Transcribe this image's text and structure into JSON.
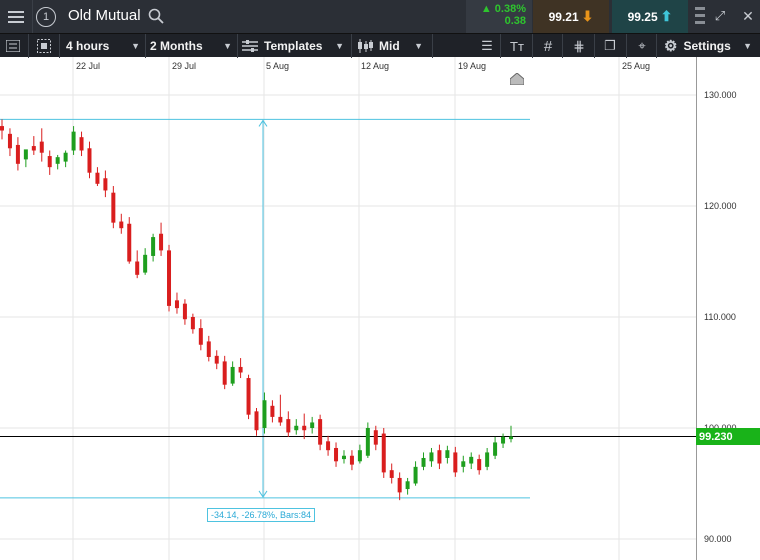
{
  "header": {
    "title": "Old Mutual",
    "change_pct": "0.38%",
    "change_abs": "0.38",
    "sell_price": "99.21",
    "buy_price": "99.25",
    "badge": "1"
  },
  "toolbar": {
    "interval": "4 hours",
    "range": "2 Months",
    "templates": "Templates",
    "price_type": "Mid",
    "settings": "Settings"
  },
  "x_axis": {
    "labels": [
      "22 Jul",
      "29 Jul",
      "5 Aug",
      "12 Aug",
      "19 Aug",
      "25 Aug"
    ]
  },
  "y_axis": {
    "labels": [
      "130.000",
      "120.000",
      "110.000",
      "100.000",
      "90.000"
    ]
  },
  "current_price": "99.230",
  "measure_label": "-34.14, -26.78%, Bars:84",
  "colors": {
    "up": "#1e9e1e",
    "down": "#d91e1e",
    "measure": "#4ec3e0",
    "price_tag": "#19b319"
  },
  "chart_data": {
    "type": "candlestick",
    "ylim": [
      89,
      132
    ],
    "candles": [
      {
        "o": 127.2,
        "h": 127.8,
        "c": 126.8,
        "l": 126.0
      },
      {
        "o": 126.5,
        "h": 127.0,
        "c": 125.2,
        "l": 124.5
      },
      {
        "o": 125.5,
        "h": 126.2,
        "c": 123.8,
        "l": 123.2
      },
      {
        "o": 124.2,
        "h": 125.0,
        "c": 125.1,
        "l": 123.5
      },
      {
        "o": 125.4,
        "h": 126.3,
        "c": 125.0,
        "l": 124.6
      },
      {
        "o": 125.8,
        "h": 127.0,
        "c": 124.8,
        "l": 124.0
      },
      {
        "o": 124.5,
        "h": 125.0,
        "c": 123.5,
        "l": 122.8
      },
      {
        "o": 123.8,
        "h": 124.6,
        "c": 124.4,
        "l": 123.3
      },
      {
        "o": 124.0,
        "h": 125.0,
        "c": 124.8,
        "l": 123.5
      },
      {
        "o": 125.0,
        "h": 127.2,
        "c": 126.7,
        "l": 124.6
      },
      {
        "o": 126.2,
        "h": 126.7,
        "c": 125.0,
        "l": 124.5
      },
      {
        "o": 125.2,
        "h": 125.8,
        "c": 123.0,
        "l": 122.5
      },
      {
        "o": 123.0,
        "h": 123.5,
        "c": 122.0,
        "l": 121.8
      },
      {
        "o": 122.5,
        "h": 123.2,
        "c": 121.4,
        "l": 120.8
      },
      {
        "o": 121.2,
        "h": 121.8,
        "c": 118.5,
        "l": 118.0
      },
      {
        "o": 118.6,
        "h": 119.3,
        "c": 118.0,
        "l": 117.5
      },
      {
        "o": 118.4,
        "h": 119.0,
        "c": 115.0,
        "l": 114.8
      },
      {
        "o": 115.0,
        "h": 116.0,
        "c": 113.8,
        "l": 113.5
      },
      {
        "o": 114.0,
        "h": 116.2,
        "c": 115.6,
        "l": 113.8
      },
      {
        "o": 115.5,
        "h": 117.5,
        "c": 117.2,
        "l": 115.0
      },
      {
        "o": 117.5,
        "h": 118.5,
        "c": 116.0,
        "l": 115.5
      },
      {
        "o": 116.0,
        "h": 116.5,
        "c": 111.0,
        "l": 110.5
      },
      {
        "o": 111.5,
        "h": 112.2,
        "c": 110.8,
        "l": 110.3
      },
      {
        "o": 111.2,
        "h": 111.6,
        "c": 109.8,
        "l": 109.3
      },
      {
        "o": 110.0,
        "h": 110.3,
        "c": 108.9,
        "l": 108.5
      },
      {
        "o": 109.0,
        "h": 109.8,
        "c": 107.5,
        "l": 107.0
      },
      {
        "o": 107.8,
        "h": 108.3,
        "c": 106.4,
        "l": 106.0
      },
      {
        "o": 106.5,
        "h": 107.0,
        "c": 105.8,
        "l": 105.3
      },
      {
        "o": 106.0,
        "h": 106.5,
        "c": 103.9,
        "l": 103.5
      },
      {
        "o": 104.0,
        "h": 106.0,
        "c": 105.5,
        "l": 103.8
      },
      {
        "o": 105.5,
        "h": 106.3,
        "c": 105.0,
        "l": 104.5
      },
      {
        "o": 104.5,
        "h": 104.8,
        "c": 101.2,
        "l": 100.8
      },
      {
        "o": 101.5,
        "h": 101.8,
        "c": 99.8,
        "l": 99.3
      },
      {
        "o": 100.0,
        "h": 103.2,
        "c": 102.5,
        "l": 99.5
      },
      {
        "o": 102.0,
        "h": 102.5,
        "c": 101.0,
        "l": 100.5
      },
      {
        "o": 101.0,
        "h": 103.0,
        "c": 100.5,
        "l": 100.2
      },
      {
        "o": 100.8,
        "h": 101.5,
        "c": 99.6,
        "l": 99.2
      },
      {
        "o": 99.8,
        "h": 100.8,
        "c": 100.2,
        "l": 99.4
      },
      {
        "o": 100.2,
        "h": 101.3,
        "c": 99.8,
        "l": 99.0
      },
      {
        "o": 100.0,
        "h": 101.0,
        "c": 100.5,
        "l": 99.5
      },
      {
        "o": 100.8,
        "h": 101.2,
        "c": 98.5,
        "l": 98.0
      },
      {
        "o": 98.8,
        "h": 99.3,
        "c": 98.0,
        "l": 97.5
      },
      {
        "o": 98.2,
        "h": 98.7,
        "c": 97.0,
        "l": 96.5
      },
      {
        "o": 97.2,
        "h": 98.0,
        "c": 97.5,
        "l": 96.8
      },
      {
        "o": 97.5,
        "h": 98.0,
        "c": 96.7,
        "l": 96.2
      },
      {
        "o": 97.0,
        "h": 98.5,
        "c": 98.0,
        "l": 96.8
      },
      {
        "o": 97.5,
        "h": 100.5,
        "c": 100.0,
        "l": 97.3
      },
      {
        "o": 99.8,
        "h": 100.2,
        "c": 98.5,
        "l": 98.0
      },
      {
        "o": 99.5,
        "h": 100.0,
        "c": 96.0,
        "l": 95.5
      },
      {
        "o": 96.2,
        "h": 96.8,
        "c": 95.5,
        "l": 95.0
      },
      {
        "o": 95.5,
        "h": 96.0,
        "c": 94.2,
        "l": 93.5
      },
      {
        "o": 94.5,
        "h": 95.5,
        "c": 95.2,
        "l": 94.0
      },
      {
        "o": 95.0,
        "h": 97.0,
        "c": 96.5,
        "l": 94.8
      },
      {
        "o": 96.5,
        "h": 97.8,
        "c": 97.3,
        "l": 96.2
      },
      {
        "o": 97.0,
        "h": 98.2,
        "c": 97.8,
        "l": 96.5
      },
      {
        "o": 98.0,
        "h": 98.5,
        "c": 96.8,
        "l": 96.3
      },
      {
        "o": 97.3,
        "h": 98.4,
        "c": 98.0,
        "l": 96.8
      },
      {
        "o": 97.8,
        "h": 98.3,
        "c": 96.0,
        "l": 95.6
      },
      {
        "o": 96.5,
        "h": 97.5,
        "c": 97.0,
        "l": 96.0
      },
      {
        "o": 96.8,
        "h": 97.8,
        "c": 97.4,
        "l": 96.3
      },
      {
        "o": 97.2,
        "h": 97.6,
        "c": 96.2,
        "l": 95.8
      },
      {
        "o": 96.5,
        "h": 98.2,
        "c": 97.8,
        "l": 96.2
      },
      {
        "o": 97.5,
        "h": 99.2,
        "c": 98.7,
        "l": 97.2
      },
      {
        "o": 98.6,
        "h": 99.5,
        "c": 99.2,
        "l": 98.2
      },
      {
        "o": 99.0,
        "h": 100.2,
        "c": 99.23,
        "l": 98.7
      }
    ],
    "horizontal_lines": [
      127.8,
      99.23,
      93.7
    ],
    "measure_range": {
      "from": 127.8,
      "to": 93.7
    }
  }
}
